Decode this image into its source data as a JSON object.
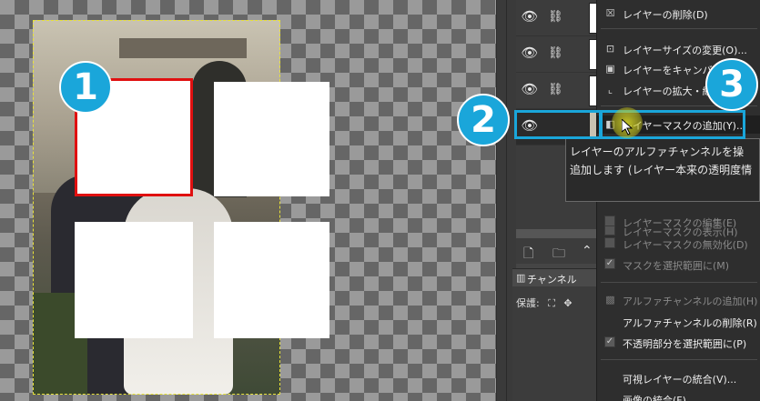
{
  "annotations": {
    "badge_1": "1",
    "badge_2": "2",
    "badge_3": "3"
  },
  "channel_tab": {
    "label": "チャンネル"
  },
  "lock_label": "保護:",
  "menu_items": [
    "レイヤーの削除(D)",
    "レイヤーサイズの変更(O)...",
    "レイヤーをキャンバスに",
    "レイヤーの拡大・縮",
    "レイヤーマスクの追加(Y)...",
    "レイヤーマスクの表示(H)",
    "レイヤーマスクの編集(E)",
    "レイヤーマスクの無効化(D)",
    "マスクを選択範囲に(M)",
    "アルファチャンネルの追加(H)",
    "アルファチャンネルの削除(R)",
    "不透明部分を選択範囲に(P)",
    "可視レイヤーの統合(V)...",
    "画像の統合(F)"
  ],
  "tooltip": {
    "line1": "レイヤーのアルファチャンネルを操",
    "line2": "追加します (レイヤー本来の透明度情"
  },
  "colors": {
    "annotation": "#1aa6da",
    "selection_red": "#e01010",
    "cursor_highlight": "#d8d828"
  },
  "icons": [
    "eye-icon",
    "chain-icon",
    "new-layer-icon",
    "new-group-icon",
    "raise-layer-icon",
    "channel-icon",
    "lock-pixels-icon",
    "lock-position-icon",
    "delete-icon",
    "resize-icon",
    "mask-icon",
    "alpha-icon",
    "cursor-icon"
  ]
}
